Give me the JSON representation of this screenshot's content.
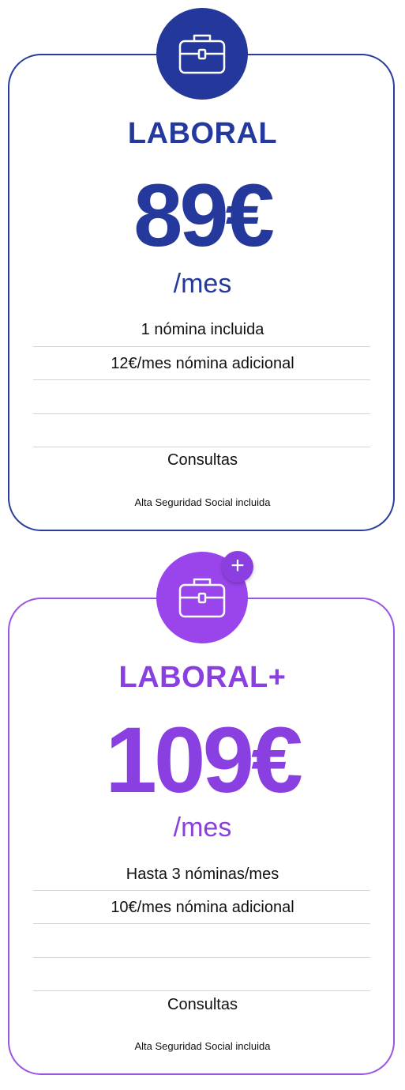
{
  "plans": [
    {
      "name": "LABORAL",
      "price": "89€",
      "period": "/mes",
      "features": [
        "1 nómina incluida",
        "12€/mes nómina adicional",
        "",
        "",
        "Consultas"
      ],
      "note": "Alta Seguridad Social incluida",
      "icon": "briefcase-icon",
      "color": "#24399b"
    },
    {
      "name": "LABORAL+",
      "price": "109€",
      "period": "/mes",
      "features": [
        "Hasta 3 nóminas/mes",
        "10€/mes nómina adicional",
        "",
        "",
        "Consultas"
      ],
      "note": "Alta Seguridad Social incluida",
      "icon": "briefcase-icon",
      "badge": "+",
      "color": "#8a3fe0"
    }
  ]
}
